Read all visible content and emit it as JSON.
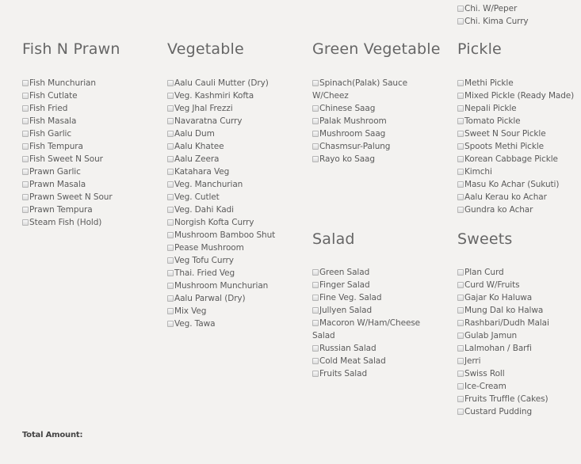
{
  "top_items": [
    "Chi. W/Peper",
    "Chi. Kima Curry"
  ],
  "categories": {
    "fish": {
      "title": "Fish N Prawn",
      "items": [
        "Fish Munchurian",
        "Fish Cutlate",
        "Fish Fried",
        "Fish Masala",
        "Fish Garlic",
        "Fish Tempura",
        "Fish Sweet N Sour",
        "Prawn Garlic",
        "Prawn Masala",
        "Prawn Sweet N Sour",
        "Prawn Tempura",
        "Steam Fish (Hold)"
      ]
    },
    "vegetable": {
      "title": "Vegetable",
      "items": [
        "Aalu Cauli Mutter (Dry)",
        "Veg. Kashmiri Kofta",
        "Veg Jhal Frezzi",
        "Navaratna Curry",
        "Aalu Dum",
        "Aalu Khatee",
        "Aalu Zeera",
        "Katahara Veg",
        "Veg. Manchurian",
        "Veg. Cutlet",
        "Veg. Dahi Kadi",
        "Norgish Kofta Curry",
        "Mushroom Bamboo Shut",
        "Pease Mushroom",
        "Veg Tofu Curry",
        "Thai. Fried Veg",
        "Mushroom Munchurian",
        "Aalu Parwal (Dry)",
        "Mix Veg",
        "Veg. Tawa"
      ]
    },
    "green": {
      "title": "Green Vegetable",
      "items": [
        "Spinach(Palak) Sauce W/Cheez",
        "Chinese Saag",
        "Palak Mushroom",
        "Mushroom Saag",
        "Chasmsur-Palung",
        "Rayo ko Saag"
      ]
    },
    "pickle": {
      "title": "Pickle",
      "items": [
        "Methi Pickle",
        "Mixed Pickle (Ready Made)",
        "Nepali Pickle",
        "Tomato Pickle",
        "Sweet N Sour Pickle",
        "Spoots Methi Pickle",
        "Korean Cabbage Pickle",
        "Kimchi",
        "Masu Ko Achar (Sukuti)",
        "Aalu Kerau ko Achar",
        "Gundra ko Achar"
      ]
    },
    "salad": {
      "title": "Salad",
      "items": [
        "Green Salad",
        "Finger Salad",
        "Fine Veg. Salad",
        "Jullyen Salad",
        "Macoron W/Ham/Cheese Salad",
        "Russian Salad",
        "Cold Meat Salad",
        "Fruits Salad"
      ]
    },
    "sweets": {
      "title": "Sweets",
      "items": [
        "Plan Curd",
        "Curd W/Fruits",
        "Gajar Ko Haluwa",
        "Mung Dal ko Halwa",
        "Rashbari/Dudh Malai",
        "Gulab Jamun",
        "Lalmohan / Barfi",
        "Jerri",
        "Swiss Roll",
        "Ice-Cream",
        "Fruits Truffle (Cakes)",
        "Custard Pudding"
      ]
    }
  },
  "total_label": "Total Amount:"
}
